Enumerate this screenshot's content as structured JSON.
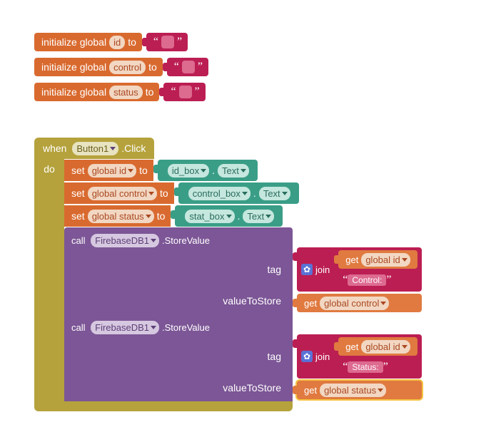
{
  "init_blocks": [
    {
      "intro": "initialize global",
      "name": "id",
      "to": "to",
      "literal": ""
    },
    {
      "intro": "initialize global",
      "name": "control",
      "to": "to",
      "literal": ""
    },
    {
      "intro": "initialize global",
      "name": "status",
      "to": "to",
      "literal": ""
    }
  ],
  "when": {
    "when_kw": "when",
    "component": "Button1",
    "event": ".Click",
    "do_kw": "do"
  },
  "set_rows": [
    {
      "set": "set",
      "var": "global id",
      "to": "to",
      "src_box": "id_box",
      "dot": ".",
      "prop": "Text"
    },
    {
      "set": "set",
      "var": "global control",
      "to": "to",
      "src_box": "control_box",
      "dot": ".",
      "prop": "Text"
    },
    {
      "set": "set",
      "var": "global status",
      "to": "to",
      "src_box": "stat_box",
      "dot": ".",
      "prop": "Text"
    }
  ],
  "call_blocks": [
    {
      "call": "call",
      "component": "FirebaseDB1",
      "method": ".StoreValue",
      "slots": {
        "tag": "tag",
        "value": "valueToStore"
      },
      "join_kw": "join",
      "join_parts": [
        {
          "kind": "get",
          "get": "get",
          "var": "global id"
        },
        {
          "kind": "str",
          "text": "Control:"
        }
      ],
      "value_get": {
        "get": "get",
        "var": "global control"
      },
      "value_selected": false
    },
    {
      "call": "call",
      "component": "FirebaseDB1",
      "method": ".StoreValue",
      "slots": {
        "tag": "tag",
        "value": "valueToStore"
      },
      "join_kw": "join",
      "join_parts": [
        {
          "kind": "get",
          "get": "get",
          "var": "global id"
        },
        {
          "kind": "str",
          "text": "Status:"
        }
      ],
      "value_get": {
        "get": "get",
        "var": "global status"
      },
      "value_selected": true
    }
  ],
  "colors": {
    "event_frame": "#b5a23c",
    "variable": "#d96a2f",
    "string": "#bb1e52",
    "procedure": "#7c5696",
    "component_prop": "#3a9e87"
  }
}
